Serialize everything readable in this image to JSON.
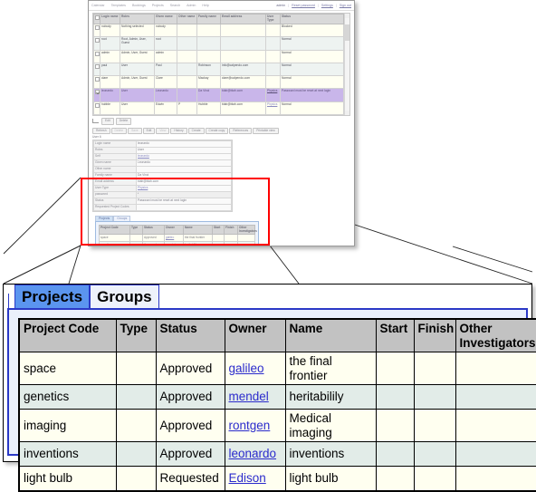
{
  "browser": {
    "nav": {
      "items": [
        "Calendar",
        "Templates",
        "Bookings",
        "Projects",
        "Search",
        "Admin",
        "Help"
      ],
      "user": "admin",
      "links": [
        "Reset password",
        "Settings",
        "Sign out"
      ],
      "separator": "|"
    },
    "users_grid": {
      "columns": [
        "",
        "Login name",
        "Roles",
        "Given name",
        "Other name",
        "Family name",
        "Email address",
        "User Type",
        "Status"
      ],
      "rows": [
        {
          "selected": false,
          "login": "nobody",
          "roles": "Nothing selected",
          "given": "nobody",
          "other": "",
          "family": "",
          "email": "",
          "usertype": "",
          "status": "Blocked"
        },
        {
          "selected": false,
          "login": "root",
          "roles": "Root, Admin, User, Guest",
          "given": "root",
          "other": "",
          "family": "",
          "email": "",
          "usertype": "",
          "status": "Normal"
        },
        {
          "selected": false,
          "login": "admin",
          "roles": "Admin, User, Guest",
          "given": "admin",
          "other": "",
          "family": "",
          "email": "",
          "usertype": "",
          "status": "Normal"
        },
        {
          "selected": false,
          "login": "paul",
          "roles": "User",
          "given": "Paul",
          "other": "",
          "family": "Robinson",
          "email": "info@calpendo.com",
          "usertype": "",
          "status": "Normal"
        },
        {
          "selected": false,
          "login": "clare",
          "roles": "Admin, User, Guest",
          "given": "Clare",
          "other": "",
          "family": "Mackay",
          "email": "clare@calpendo.com",
          "usertype": "",
          "status": "Normal"
        },
        {
          "selected": true,
          "login": "leonardo",
          "roles": "User",
          "given": "Leonardo",
          "other": "",
          "family": "Da Vinci",
          "email": "blah@blah.com",
          "usertype": "Physics",
          "status": "Password must be reset at next login"
        },
        {
          "selected": false,
          "login": "hubble",
          "roles": "User",
          "given": "Edwin",
          "other": "P",
          "family": "Hubble",
          "email": "blah@blah.com",
          "usertype": "Physics",
          "status": "Normal"
        }
      ]
    },
    "grid_buttons": [
      "Edit",
      "Delete"
    ],
    "toolbar": [
      "Refresh",
      "Delete",
      "Save",
      "Edit",
      "View",
      "History",
      "Create",
      "Create copy",
      "References",
      "Printable view"
    ],
    "record_label": "User 6",
    "detail_fields": [
      {
        "label": "Login name",
        "value": "leonardo",
        "link": false
      },
      {
        "label": "Roles",
        "value": "User",
        "link": false
      },
      {
        "label": "Self",
        "value": "leonardo",
        "link": true
      },
      {
        "label": "Given name",
        "value": "Leonardo",
        "link": false
      },
      {
        "label": "Other name",
        "value": "",
        "link": false
      },
      {
        "label": "Family name",
        "value": "Da Vinci",
        "link": false
      },
      {
        "label": "Email address",
        "value": "blah@blah.com",
        "link": false
      },
      {
        "label": "User Type",
        "value": "Physics",
        "link": true
      },
      {
        "label": "password",
        "value": "*",
        "link": false
      },
      {
        "label": "Status",
        "value": "Password must be reset at next login",
        "link": false
      },
      {
        "label": "Requested Project Codes",
        "value": "",
        "link": false
      }
    ],
    "inner_tabs": [
      {
        "label": "Projects",
        "active": true
      },
      {
        "label": "Groups",
        "active": false
      }
    ]
  },
  "magnified": {
    "tabs": [
      {
        "label": "Projects",
        "active": true
      },
      {
        "label": "Groups",
        "active": false
      }
    ],
    "table": {
      "columns": [
        "Project Code",
        "Type",
        "Status",
        "Owner",
        "Name",
        "Start",
        "Finish",
        "Other Investigators"
      ],
      "rows": [
        {
          "code": "space",
          "type": "",
          "status": "Approved",
          "owner": "galileo",
          "name": "the final frontier",
          "start": "",
          "finish": "",
          "others": ""
        },
        {
          "code": "genetics",
          "type": "",
          "status": "Approved",
          "owner": "mendel",
          "name": "heritabilily",
          "start": "",
          "finish": "",
          "others": ""
        },
        {
          "code": "imaging",
          "type": "",
          "status": "Approved",
          "owner": "rontgen",
          "name": "Medical imaging",
          "start": "",
          "finish": "",
          "others": ""
        },
        {
          "code": "inventions",
          "type": "",
          "status": "Approved",
          "owner": "leonardo",
          "name": "inventions",
          "start": "",
          "finish": "",
          "others": ""
        },
        {
          "code": "light bulb",
          "type": "",
          "status": "Requested",
          "owner": "Edison",
          "name": "light bulb",
          "start": "",
          "finish": "",
          "others": ""
        }
      ]
    }
  },
  "colors": {
    "highlight_box": "#ff0000",
    "tab_active": "#5b95ef",
    "tab_border": "#2b39c6",
    "header_gray": "#c2c2c2",
    "row_odd": "#fffff0",
    "row_even": "#e2ece8",
    "link": "#2b2bcc",
    "selected_row": "#c9b6ea"
  }
}
